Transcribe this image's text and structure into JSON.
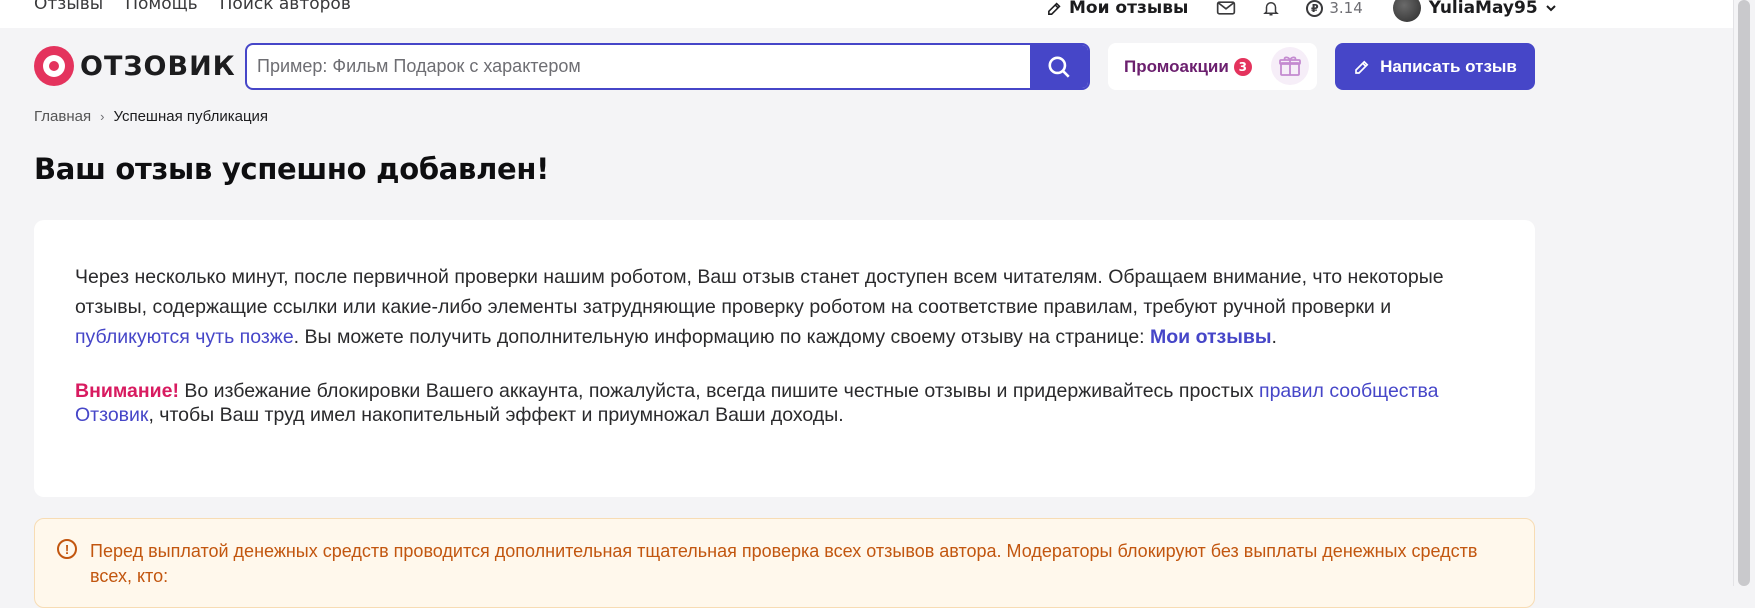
{
  "topnav": {
    "items": [
      "Отзывы",
      "Помощь",
      "Поиск авторов"
    ],
    "my_reviews": "Мои отзывы",
    "balance": "3.14",
    "coin_symbol": "₽",
    "username": "YuliaMay95"
  },
  "header": {
    "logo_text": "ОТЗОВИК",
    "search_placeholder": "Пример: Фильм Подарок с характером",
    "promo_label": "Промоакции",
    "promo_count": "3",
    "write_button": "Написать отзыв"
  },
  "breadcrumb": {
    "home": "Главная",
    "separator": "›",
    "current": "Успешная публикация"
  },
  "page": {
    "title": "Ваш отзыв успешно добавлен!"
  },
  "card": {
    "para1_text1": "Через несколько минут, после первичной проверки нашим роботом, Ваш отзыв станет доступен всем читателям. Обращаем внимание, что некоторые отзывы, содержащие ссылки или какие-либо элементы затрудняющие проверку роботом на соответствие правилам, требуют ручной проверки и ",
    "para1_link1": "публикуются чуть позже",
    "para1_text2": ". Вы можете получить дополнительную информацию по каждому своему отзыву на странице: ",
    "para1_link2": "Мои отзывы",
    "para1_text3": ".",
    "para2_warning": "Внимание!",
    "para2_text1": " Во избежание блокировки Вашего аккаунта, пожалуйста, всегда пишите честные отзывы и придерживайтесь простых ",
    "para2_link": "правил сообщества Отзовик",
    "para2_text2": ", чтобы Ваш труд имел накопительный эффект и приумножал Ваши доходы."
  },
  "notice": {
    "icon": "!",
    "text": "Перед выплатой денежных средств проводится дополнительная тщательная проверка всех отзывов автора. Модераторы блокируют без выплаты денежных средств всех, кто:"
  },
  "colors": {
    "accent": "#4646c8",
    "brand": "#e4335d",
    "warning_text": "#c2560f",
    "promo_text": "#6b1f6e"
  },
  "icons": {
    "pencil": "pencil-icon",
    "mail": "mail-icon",
    "bell": "bell-icon",
    "coin": "ruble-coin-icon",
    "chevron": "chevron-down-icon",
    "search": "search-icon",
    "gift": "gift-icon",
    "notice": "exclamation-circle-icon"
  }
}
